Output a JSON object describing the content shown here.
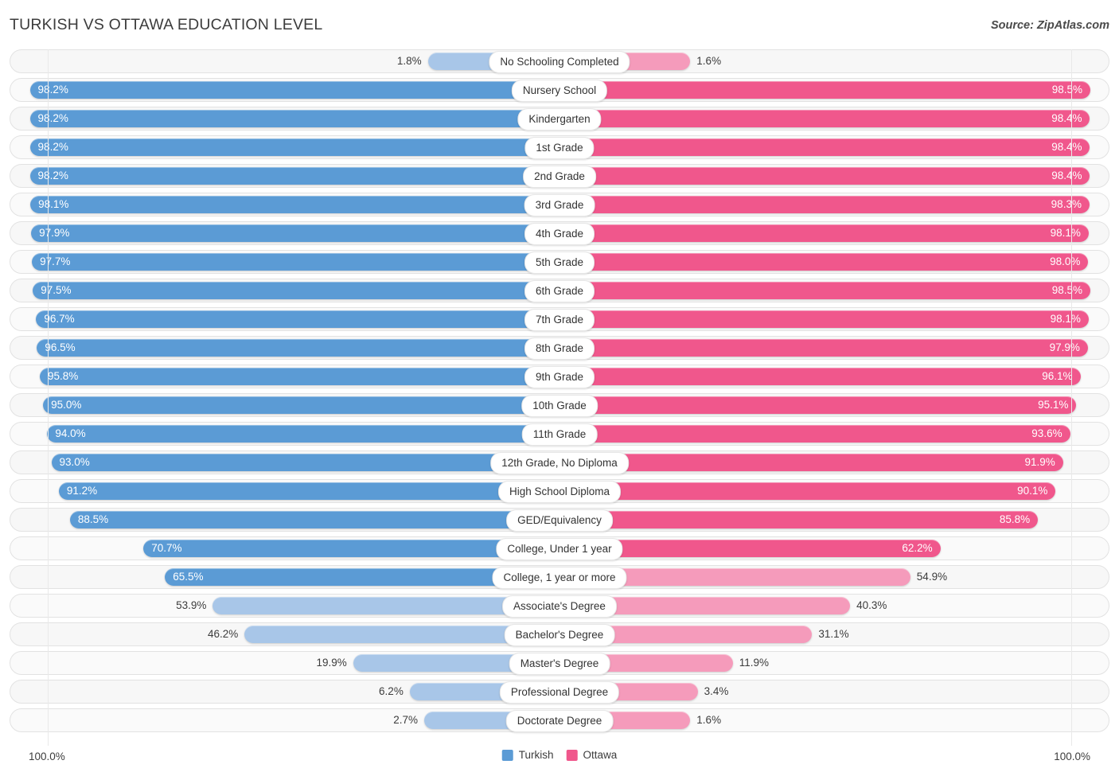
{
  "header": {
    "title": "TURKISH VS OTTAWA EDUCATION LEVEL",
    "source": "Source: ZipAtlas.com"
  },
  "legend": {
    "series_left": "Turkish",
    "series_right": "Ottawa",
    "color_left": "#5b9bd5",
    "color_right": "#f0578c",
    "color_left_light": "#a8c6e8",
    "color_right_light": "#f59bbb"
  },
  "axis": {
    "left_max": "100.0%",
    "right_max": "100.0%"
  },
  "chart_data": {
    "type": "bar",
    "title": "TURKISH VS OTTAWA EDUCATION LEVEL",
    "orientation": "horizontal-diverging",
    "xlabel": "",
    "ylabel": "",
    "xlim": [
      0,
      100
    ],
    "grid": false,
    "legend_position": "bottom-center",
    "categories": [
      "No Schooling Completed",
      "Nursery School",
      "Kindergarten",
      "1st Grade",
      "2nd Grade",
      "3rd Grade",
      "4th Grade",
      "5th Grade",
      "6th Grade",
      "7th Grade",
      "8th Grade",
      "9th Grade",
      "10th Grade",
      "11th Grade",
      "12th Grade, No Diploma",
      "High School Diploma",
      "GED/Equivalency",
      "College, Under 1 year",
      "College, 1 year or more",
      "Associate's Degree",
      "Bachelor's Degree",
      "Master's Degree",
      "Professional Degree",
      "Doctorate Degree"
    ],
    "series": [
      {
        "name": "Turkish",
        "values": [
          1.8,
          98.2,
          98.2,
          98.2,
          98.2,
          98.1,
          97.9,
          97.7,
          97.5,
          96.7,
          96.5,
          95.8,
          95.0,
          94.0,
          93.0,
          91.2,
          88.5,
          70.7,
          65.5,
          53.9,
          46.2,
          19.9,
          6.2,
          2.7
        ],
        "labels": [
          "1.8%",
          "98.2%",
          "98.2%",
          "98.2%",
          "98.2%",
          "98.1%",
          "97.9%",
          "97.7%",
          "97.5%",
          "96.7%",
          "96.5%",
          "95.8%",
          "95.0%",
          "94.0%",
          "93.0%",
          "91.2%",
          "88.5%",
          "70.7%",
          "65.5%",
          "53.9%",
          "46.2%",
          "19.9%",
          "6.2%",
          "2.7%"
        ]
      },
      {
        "name": "Ottawa",
        "values": [
          1.6,
          98.5,
          98.4,
          98.4,
          98.4,
          98.3,
          98.1,
          98.0,
          98.5,
          98.1,
          97.9,
          96.1,
          95.1,
          93.6,
          91.9,
          90.1,
          85.8,
          62.2,
          54.9,
          40.3,
          31.1,
          11.9,
          3.4,
          1.6
        ],
        "labels": [
          "1.6%",
          "98.5%",
          "98.4%",
          "98.4%",
          "98.4%",
          "98.3%",
          "98.1%",
          "98.0%",
          "98.5%",
          "98.1%",
          "97.9%",
          "96.1%",
          "95.1%",
          "93.6%",
          "91.9%",
          "90.1%",
          "85.8%",
          "62.2%",
          "54.9%",
          "40.3%",
          "31.1%",
          "11.9%",
          "3.4%",
          "1.6%"
        ]
      }
    ]
  }
}
